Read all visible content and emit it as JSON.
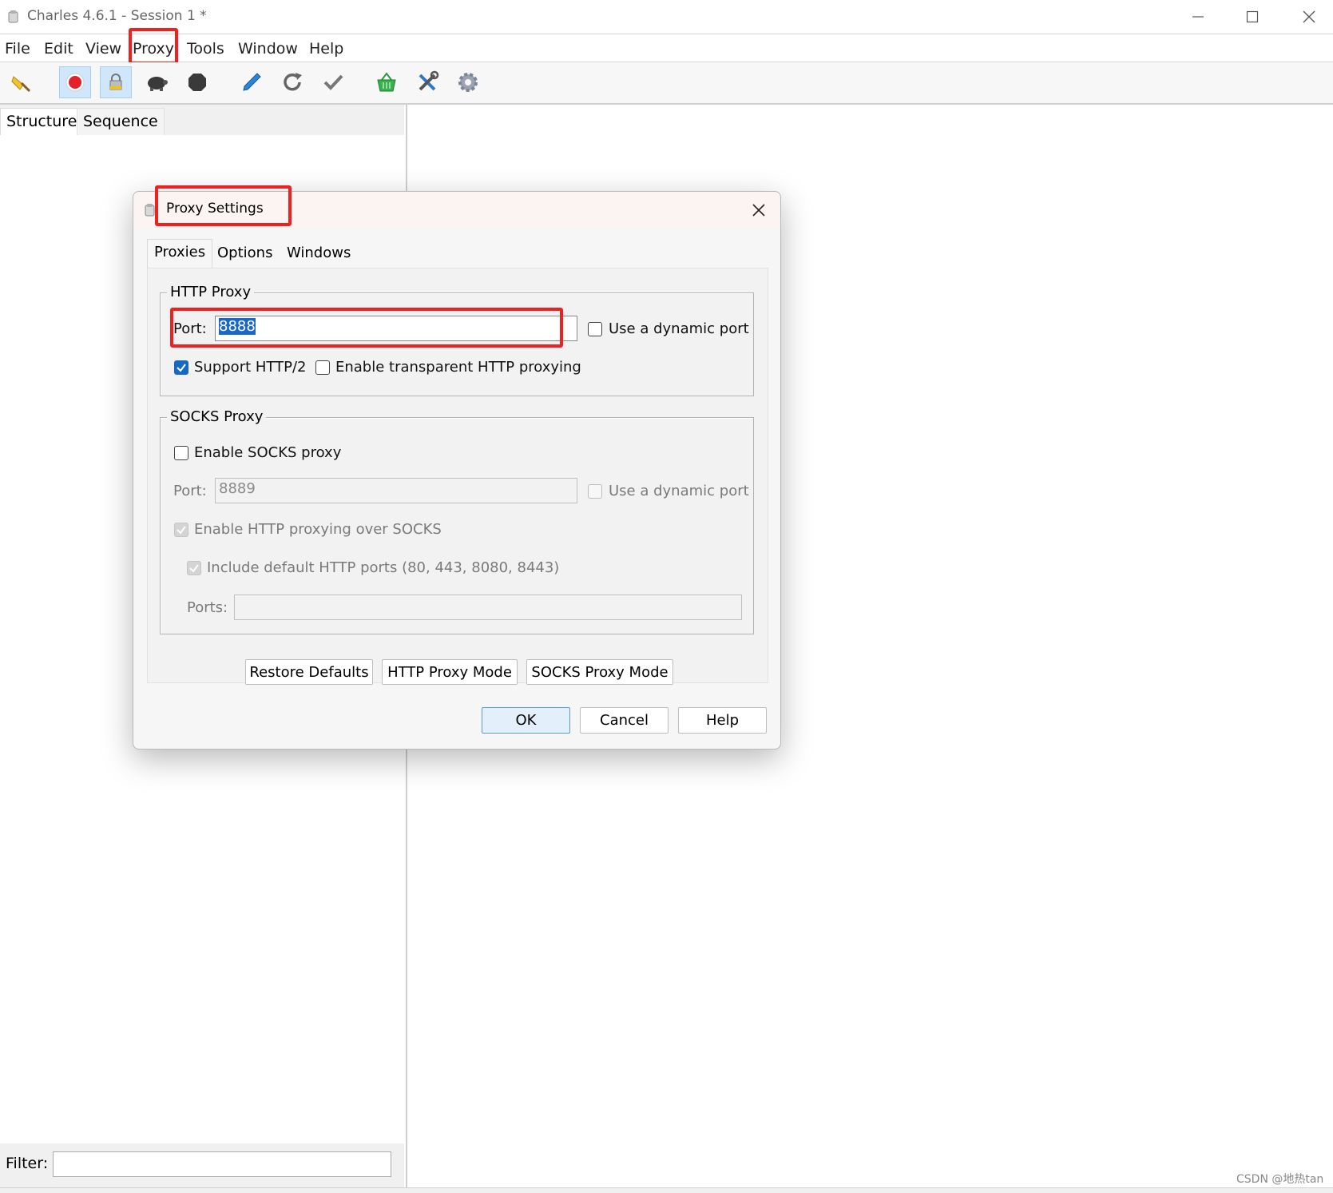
{
  "window": {
    "title": "Charles 4.6.1 - Session 1 *"
  },
  "menu": {
    "items": [
      "File",
      "Edit",
      "View",
      "Proxy",
      "Tools",
      "Window",
      "Help"
    ]
  },
  "toolbar": {
    "icons": [
      "broom-icon",
      "record-icon",
      "ssl-lock-icon",
      "turtle-icon",
      "stop-icon",
      "pen-icon",
      "refresh-icon",
      "check-icon",
      "basket-icon",
      "tools-icon",
      "gear-icon"
    ]
  },
  "left_pane": {
    "tabs": [
      "Structure",
      "Sequence"
    ],
    "filter_label": "Filter:",
    "filter_value": ""
  },
  "dialog": {
    "title": "Proxy Settings",
    "tabs": [
      "Proxies",
      "Options",
      "Windows"
    ],
    "http_proxy": {
      "legend": "HTTP Proxy",
      "port_label": "Port:",
      "port_value": "8888",
      "dynamic_port_label": "Use a dynamic port",
      "dynamic_port_checked": false,
      "support_http2_label": "Support HTTP/2",
      "support_http2_checked": true,
      "transparent_label": "Enable transparent HTTP proxying",
      "transparent_checked": false
    },
    "socks_proxy": {
      "legend": "SOCKS Proxy",
      "enable_label": "Enable SOCKS proxy",
      "enable_checked": false,
      "port_label": "Port:",
      "port_value": "8889",
      "dynamic_port_label": "Use a dynamic port",
      "http_over_socks_label": "Enable HTTP proxying over SOCKS",
      "include_default_label": "Include default HTTP ports (80, 443, 8080, 8443)",
      "ports_label": "Ports:",
      "ports_value": ""
    },
    "panel_buttons": [
      "Restore Defaults",
      "HTTP Proxy Mode",
      "SOCKS Proxy Mode"
    ],
    "footer_buttons": [
      "OK",
      "Cancel",
      "Help"
    ]
  },
  "watermark": "CSDN @地热tan",
  "colors": {
    "highlight": "#ee2020",
    "accent": "#1469c7"
  }
}
